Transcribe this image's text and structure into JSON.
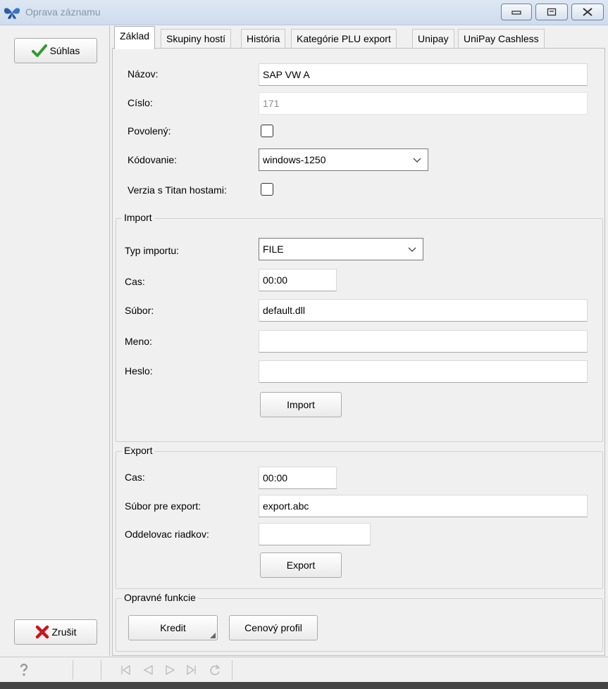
{
  "window": {
    "title": "Oprava záznamu",
    "icon": "butterfly-icon",
    "buttons": [
      "minimize",
      "maximize",
      "close"
    ]
  },
  "sidebar": {
    "ok_label": "Súhlas",
    "cancel_label": "Zrušit",
    "ok_icon": "checkmark-icon",
    "cancel_icon": "red-x-icon",
    "accent_ok": "#2e9b2e",
    "accent_cancel": "#c8161d"
  },
  "tabs": [
    {
      "label": "Základ",
      "active": true
    },
    {
      "label": "Skupiny hostí",
      "active": false
    },
    {
      "label": "História",
      "active": false
    },
    {
      "label": "Kategórie PLU export",
      "active": false
    },
    {
      "label": "Unipay",
      "active": false
    },
    {
      "label": "UniPay Cashless",
      "active": false
    }
  ],
  "zaklad": {
    "nazov_label": "Názov:",
    "nazov_value": "SAP VW A",
    "cislo_label": "Císlo:",
    "cislo_value": "171",
    "povoleny_label": "Povolený:",
    "povoleny_checked": false,
    "kodovanie_label": "Kódovanie:",
    "kodovanie_value": "windows-1250",
    "verzia_label": "Verzia s Titan hostami:",
    "verzia_checked": false
  },
  "import": {
    "group_title": "Import",
    "typ_label": "Typ importu:",
    "typ_value": "FILE",
    "cas_label": "Cas:",
    "cas_value": "00:00",
    "subor_label": "Súbor:",
    "subor_value": "default.dll",
    "meno_label": "Meno:",
    "meno_value": "",
    "heslo_label": "Heslo:",
    "heslo_value": "",
    "button_label": "Import"
  },
  "export": {
    "group_title": "Export",
    "cas_label": "Cas:",
    "cas_value": "00:00",
    "subor_label": "Súbor pre export:",
    "subor_value": "export.abc",
    "oddelovac_label": "Oddelovac riadkov:",
    "oddelovac_value": "",
    "button_label": "Export"
  },
  "opravne": {
    "group_title": "Opravné funkcie",
    "kredit_label": "Kredit",
    "cenovy_label": "Cenový profil"
  },
  "statusbar": {
    "help_icon": "question-mark-icon",
    "nav_icons": [
      "first-record-icon",
      "prev-record-icon",
      "next-record-icon",
      "last-record-icon",
      "refresh-icon"
    ]
  }
}
